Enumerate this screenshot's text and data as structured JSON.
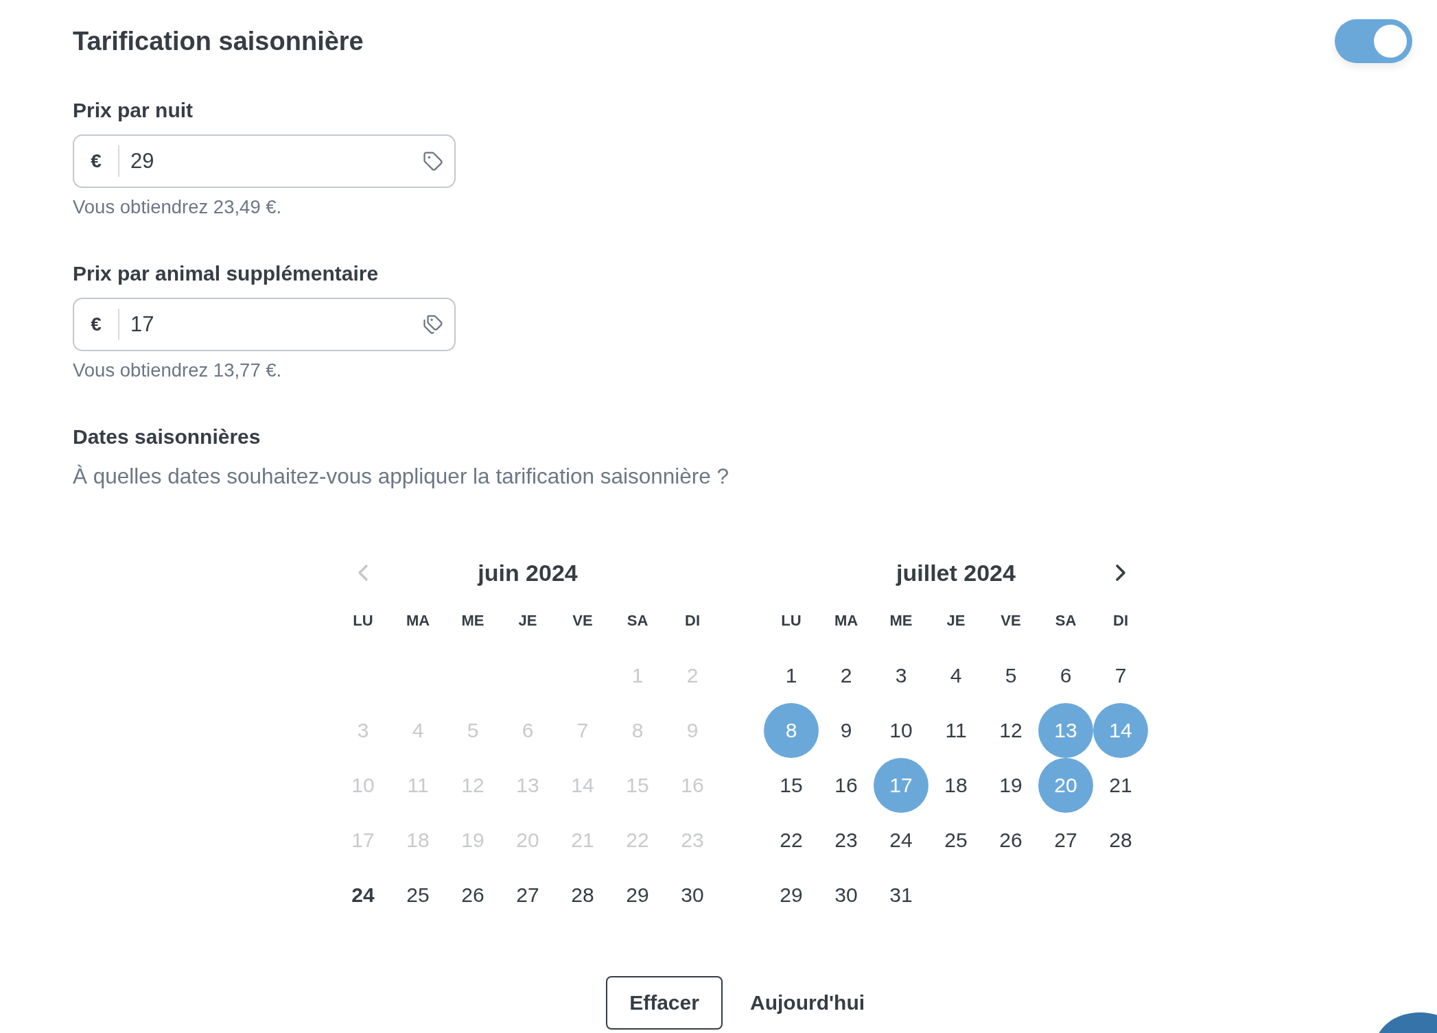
{
  "header": {
    "title": "Tarification saisonnière",
    "toggle": {
      "on": true
    }
  },
  "price_fields": [
    {
      "label": "Prix par nuit",
      "currency": "€",
      "value": "29",
      "helper": "Vous obtiendrez 23,49 €."
    },
    {
      "label": "Prix par animal supplémentaire",
      "currency": "€",
      "value": "17",
      "helper": "Vous obtiendrez 13,77 €."
    }
  ],
  "dates_section": {
    "title": "Dates saisonnières",
    "question": "À quelles dates souhaitez-vous appliquer la tarification saisonnière ?"
  },
  "calendar": {
    "months": [
      {
        "title": "juin 2024",
        "weekdays": [
          "LU",
          "MA",
          "ME",
          "JE",
          "VE",
          "SA",
          "DI"
        ],
        "weeks": [
          [
            {
              "kind": "blank"
            },
            {
              "kind": "blank"
            },
            {
              "kind": "blank"
            },
            {
              "kind": "blank"
            },
            {
              "kind": "blank"
            },
            {
              "label": "1",
              "kind": "past",
              "selected": false
            },
            {
              "label": "2",
              "kind": "past",
              "selected": false
            }
          ],
          [
            {
              "label": "3",
              "kind": "past",
              "selected": false
            },
            {
              "label": "4",
              "kind": "past",
              "selected": false
            },
            {
              "label": "5",
              "kind": "past",
              "selected": false
            },
            {
              "label": "6",
              "kind": "past",
              "selected": false
            },
            {
              "label": "7",
              "kind": "past",
              "selected": false
            },
            {
              "label": "8",
              "kind": "past",
              "selected": false
            },
            {
              "label": "9",
              "kind": "past",
              "selected": false
            }
          ],
          [
            {
              "label": "10",
              "kind": "past",
              "selected": false
            },
            {
              "label": "11",
              "kind": "past",
              "selected": false
            },
            {
              "label": "12",
              "kind": "past",
              "selected": false
            },
            {
              "label": "13",
              "kind": "past",
              "selected": false
            },
            {
              "label": "14",
              "kind": "past",
              "selected": false
            },
            {
              "label": "15",
              "kind": "past",
              "selected": false
            },
            {
              "label": "16",
              "kind": "past",
              "selected": false
            }
          ],
          [
            {
              "label": "17",
              "kind": "past",
              "selected": false
            },
            {
              "label": "18",
              "kind": "past",
              "selected": false
            },
            {
              "label": "19",
              "kind": "past",
              "selected": false
            },
            {
              "label": "20",
              "kind": "past",
              "selected": false
            },
            {
              "label": "21",
              "kind": "past",
              "selected": false
            },
            {
              "label": "22",
              "kind": "past",
              "selected": false
            },
            {
              "label": "23",
              "kind": "past",
              "selected": false
            }
          ],
          [
            {
              "label": "24",
              "kind": "today",
              "selected": false
            },
            {
              "label": "25",
              "kind": "day",
              "selected": false
            },
            {
              "label": "26",
              "kind": "day",
              "selected": false
            },
            {
              "label": "27",
              "kind": "day",
              "selected": false
            },
            {
              "label": "28",
              "kind": "day",
              "selected": false
            },
            {
              "label": "29",
              "kind": "day",
              "selected": false
            },
            {
              "label": "30",
              "kind": "day",
              "selected": false
            }
          ]
        ]
      },
      {
        "title": "juillet 2024",
        "weekdays": [
          "LU",
          "MA",
          "ME",
          "JE",
          "VE",
          "SA",
          "DI"
        ],
        "weeks": [
          [
            {
              "label": "1",
              "kind": "day",
              "selected": false
            },
            {
              "label": "2",
              "kind": "day",
              "selected": false
            },
            {
              "label": "3",
              "kind": "day",
              "selected": false
            },
            {
              "label": "4",
              "kind": "day",
              "selected": false
            },
            {
              "label": "5",
              "kind": "day",
              "selected": false
            },
            {
              "label": "6",
              "kind": "day",
              "selected": false
            },
            {
              "label": "7",
              "kind": "day",
              "selected": false
            }
          ],
          [
            {
              "label": "8",
              "kind": "day",
              "selected": true
            },
            {
              "label": "9",
              "kind": "day",
              "selected": false
            },
            {
              "label": "10",
              "kind": "day",
              "selected": false
            },
            {
              "label": "11",
              "kind": "day",
              "selected": false
            },
            {
              "label": "12",
              "kind": "day",
              "selected": false
            },
            {
              "label": "13",
              "kind": "day",
              "selected": true
            },
            {
              "label": "14",
              "kind": "day",
              "selected": true
            }
          ],
          [
            {
              "label": "15",
              "kind": "day",
              "selected": false
            },
            {
              "label": "16",
              "kind": "day",
              "selected": false
            },
            {
              "label": "17",
              "kind": "day",
              "selected": true
            },
            {
              "label": "18",
              "kind": "day",
              "selected": false
            },
            {
              "label": "19",
              "kind": "day",
              "selected": false
            },
            {
              "label": "20",
              "kind": "day",
              "selected": true
            },
            {
              "label": "21",
              "kind": "day",
              "selected": false
            }
          ],
          [
            {
              "label": "22",
              "kind": "day",
              "selected": false
            },
            {
              "label": "23",
              "kind": "day",
              "selected": false
            },
            {
              "label": "24",
              "kind": "day",
              "selected": false
            },
            {
              "label": "25",
              "kind": "day",
              "selected": false
            },
            {
              "label": "26",
              "kind": "day",
              "selected": false
            },
            {
              "label": "27",
              "kind": "day",
              "selected": false
            },
            {
              "label": "28",
              "kind": "day",
              "selected": false
            }
          ],
          [
            {
              "label": "29",
              "kind": "day",
              "selected": false
            },
            {
              "label": "30",
              "kind": "day",
              "selected": false
            },
            {
              "label": "31",
              "kind": "day",
              "selected": false
            },
            {
              "kind": "blank"
            },
            {
              "kind": "blank"
            },
            {
              "kind": "blank"
            },
            {
              "kind": "blank"
            }
          ]
        ]
      }
    ]
  },
  "footer": {
    "clear_button": "Effacer",
    "today_button": "Aujourd'hui"
  }
}
